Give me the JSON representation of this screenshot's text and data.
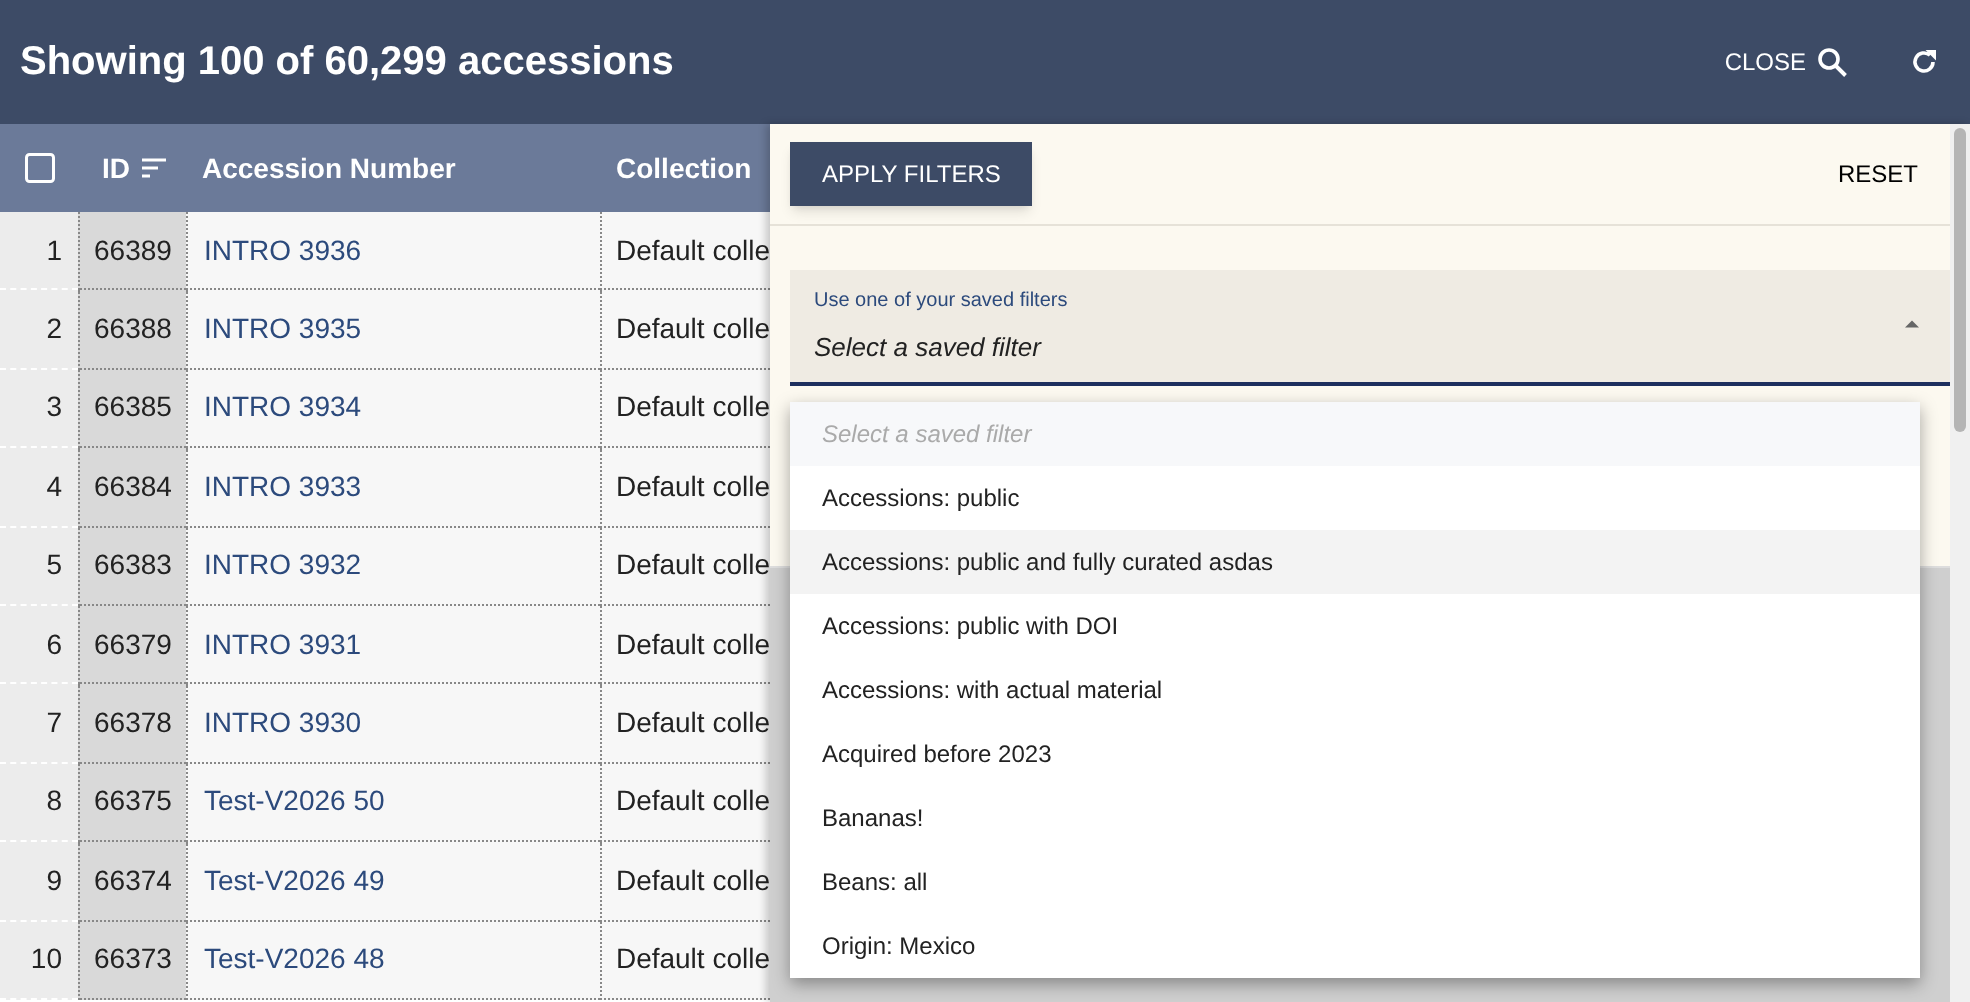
{
  "header": {
    "title": "Showing 100 of 60,299 accessions",
    "close_label": "CLOSE"
  },
  "table": {
    "columns": [
      "ID",
      "Accession Number",
      "Collection"
    ],
    "all_checked": false,
    "rows": [
      {
        "number": "1",
        "id": "66389",
        "accession_number": "INTRO 3936",
        "collection": "Default colle"
      },
      {
        "number": "2",
        "id": "66388",
        "accession_number": "INTRO 3935",
        "collection": "Default colle"
      },
      {
        "number": "3",
        "id": "66385",
        "accession_number": "INTRO 3934",
        "collection": "Default colle"
      },
      {
        "number": "4",
        "id": "66384",
        "accession_number": "INTRO 3933",
        "collection": "Default colle"
      },
      {
        "number": "5",
        "id": "66383",
        "accession_number": "INTRO 3932",
        "collection": "Default colle"
      },
      {
        "number": "6",
        "id": "66379",
        "accession_number": "INTRO 3931",
        "collection": "Default colle"
      },
      {
        "number": "7",
        "id": "66378",
        "accession_number": "INTRO 3930",
        "collection": "Default colle"
      },
      {
        "number": "8",
        "id": "66375",
        "accession_number": "Test-V2026 50",
        "collection": "Default colle"
      },
      {
        "number": "9",
        "id": "66374",
        "accession_number": "Test-V2026 49",
        "collection": "Default colle"
      },
      {
        "number": "10",
        "id": "66373",
        "accession_number": "Test-V2026 48",
        "collection": "Default colle"
      }
    ]
  },
  "filter_panel": {
    "apply_button": "APPLY FILTERS",
    "reset_button": "RESET",
    "saved_filter_select": {
      "label": "Use one of your saved filters",
      "placeholder": "Select a saved filter",
      "expanded": true,
      "options": [
        {
          "label": "Select a saved filter",
          "kind": "placeholder"
        },
        {
          "label": "Accessions: public",
          "kind": "option",
          "highlighted": false
        },
        {
          "label": "Accessions: public and fully curated asdas",
          "kind": "option",
          "highlighted": true
        },
        {
          "label": "Accessions: public with DOI",
          "kind": "option",
          "highlighted": false
        },
        {
          "label": "Accessions: with actual material",
          "kind": "option",
          "highlighted": false
        },
        {
          "label": "Acquired before 2023",
          "kind": "option",
          "highlighted": false
        },
        {
          "label": "Bananas!",
          "kind": "option",
          "highlighted": false
        },
        {
          "label": "Beans: all",
          "kind": "option",
          "highlighted": false
        },
        {
          "label": "Origin: Mexico",
          "kind": "option",
          "highlighted": false
        }
      ]
    }
  }
}
